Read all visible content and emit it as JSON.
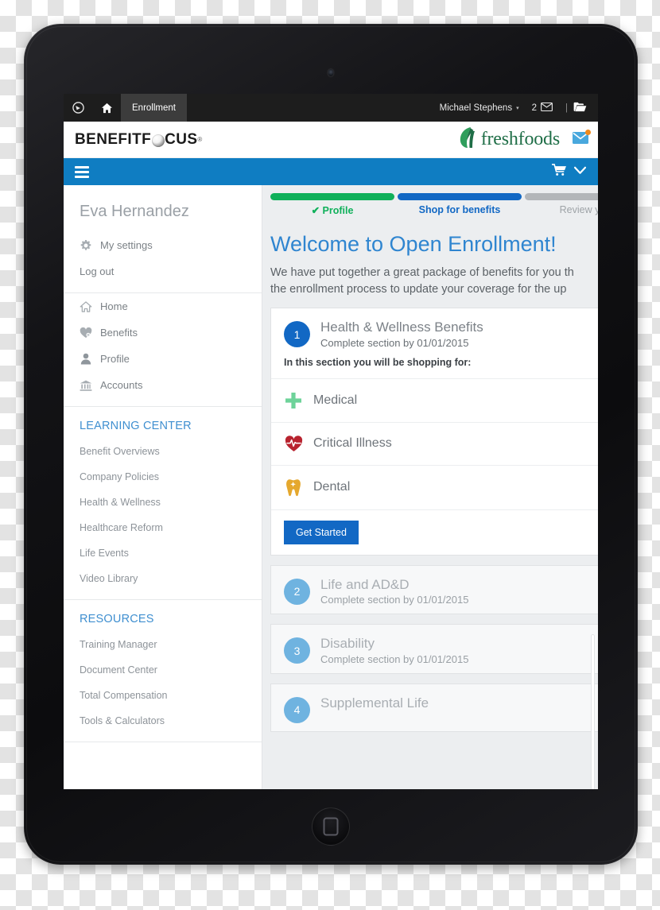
{
  "topbar": {
    "logo_icon": "benefitfocus-circle-icon",
    "home_icon": "home-icon",
    "active_tab": "Enrollment",
    "user_name": "Michael Stephens",
    "caret": "▾",
    "mail_count": "2",
    "mail_icon": "envelope-icon",
    "separator": "|",
    "folder_icon": "folder-open-icon"
  },
  "brandbar": {
    "logo_part1": "BENEFITF",
    "logo_o": "O",
    "logo_part2": "CUS",
    "logo_reg": "®",
    "client_logo_icon": "leaf-icon",
    "client_name": "freshfoods",
    "mail_icon": "envelope-icon",
    "mail_badge": "new-message-badge"
  },
  "navbar": {
    "menu_icon": "hamburger-menu-icon",
    "cart_icon": "shopping-cart-icon",
    "caret_icon": "chevron-down-icon"
  },
  "sidebar": {
    "user_name": "Eva Hernandez",
    "account_links": [
      {
        "label": "My settings",
        "icon": "gear-icon"
      },
      {
        "label": "Log out",
        "icon": ""
      }
    ],
    "nav_links": [
      {
        "label": "Home",
        "icon": "home-icon"
      },
      {
        "label": "Benefits",
        "icon": "heart-icon"
      },
      {
        "label": "Profile",
        "icon": "user-icon"
      },
      {
        "label": "Accounts",
        "icon": "bank-icon"
      }
    ],
    "sections": [
      {
        "heading": "LEARNING CENTER",
        "items": [
          "Benefit Overviews",
          "Company Policies",
          "Health & Wellness",
          "Healthcare Reform",
          "Life Events",
          "Video Library"
        ]
      },
      {
        "heading": "RESOURCES",
        "items": [
          "Training Manager",
          "Document Center",
          "Total Compensation",
          "Tools & Calculators"
        ]
      }
    ]
  },
  "main": {
    "steps": [
      {
        "label": "✔ Profile",
        "state": "done"
      },
      {
        "label": "Shop for benefits",
        "state": "active"
      },
      {
        "label": "Review your",
        "state": "todo"
      }
    ],
    "welcome_title": "Welcome to Open Enrollment!",
    "intro_line1": "We have put together a great package of benefits for you th",
    "intro_line2": "the enrollment process to update your coverage for the up",
    "cards": [
      {
        "number": "1",
        "title": "Health & Wellness Benefits",
        "subtitle": "Complete section by 01/01/2015",
        "note": "In this section you will be shopping for:",
        "benefits": [
          {
            "label": "Medical",
            "icon": "medical-cross-icon"
          },
          {
            "label": "Critical Illness",
            "icon": "heart-pulse-icon"
          },
          {
            "label": "Dental",
            "icon": "tooth-icon"
          }
        ],
        "action_label": "Get Started"
      },
      {
        "number": "2",
        "title": "Life and AD&D",
        "subtitle": "Complete section by 01/01/2015"
      },
      {
        "number": "3",
        "title": "Disability",
        "subtitle": "Complete section by 01/01/2015"
      },
      {
        "number": "4",
        "title": "Supplemental Life",
        "subtitle": ""
      }
    ]
  },
  "colors": {
    "brand_blue": "#0f7dc2",
    "accent_blue": "#1268c4",
    "link_blue": "#3f8fd0",
    "done_green": "#0fb05a",
    "todo_gray": "#b3b6b9",
    "client_green": "#1f6e47",
    "badge_orange": "#f08a1c",
    "muted_badge_blue": "#6fb3e0"
  }
}
